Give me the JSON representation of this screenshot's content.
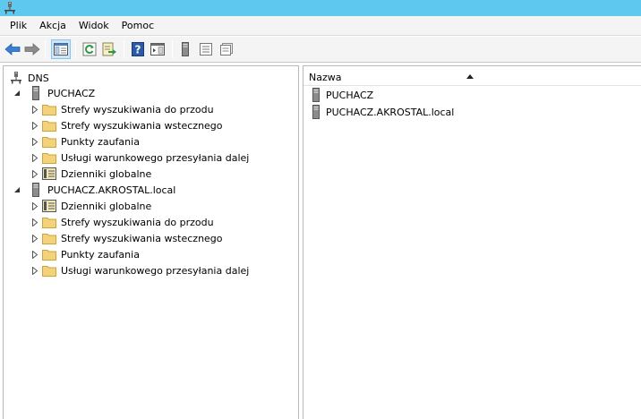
{
  "menu": [
    "Plik",
    "Akcja",
    "Widok",
    "Pomoc"
  ],
  "toolbar": {
    "buttons": [
      "back-icon",
      "forward-icon",
      "show-hide-tree-icon",
      "refresh-icon",
      "export-list-icon",
      "help-icon",
      "action-pane-icon",
      "server-icon",
      "list-icon",
      "details-icon"
    ]
  },
  "tree": {
    "root": "DNS",
    "servers": [
      {
        "name": "PUCHACZ",
        "children": [
          {
            "label": "Strefy wyszukiwania do przodu",
            "icon": "folder-icon"
          },
          {
            "label": "Strefy wyszukiwania wstecznego",
            "icon": "folder-icon"
          },
          {
            "label": "Punkty zaufania",
            "icon": "folder-icon"
          },
          {
            "label": "Usługi warunkowego przesyłania dalej",
            "icon": "folder-icon"
          },
          {
            "label": "Dzienniki globalne",
            "icon": "log-icon"
          }
        ]
      },
      {
        "name": "PUCHACZ.AKROSTAL.local",
        "children": [
          {
            "label": "Dzienniki globalne",
            "icon": "log-icon"
          },
          {
            "label": "Strefy wyszukiwania do przodu",
            "icon": "folder-icon"
          },
          {
            "label": "Strefy wyszukiwania wstecznego",
            "icon": "folder-icon"
          },
          {
            "label": "Punkty zaufania",
            "icon": "folder-icon"
          },
          {
            "label": "Usługi warunkowego przesyłania dalej",
            "icon": "folder-icon"
          }
        ]
      }
    ]
  },
  "list": {
    "column_header": "Nazwa",
    "items": [
      "PUCHACZ",
      "PUCHACZ.AKROSTAL.local"
    ]
  },
  "colors": {
    "titlebar": "#5ec8ef",
    "folder": "#f3d27a",
    "selection": "#cde6f7"
  }
}
